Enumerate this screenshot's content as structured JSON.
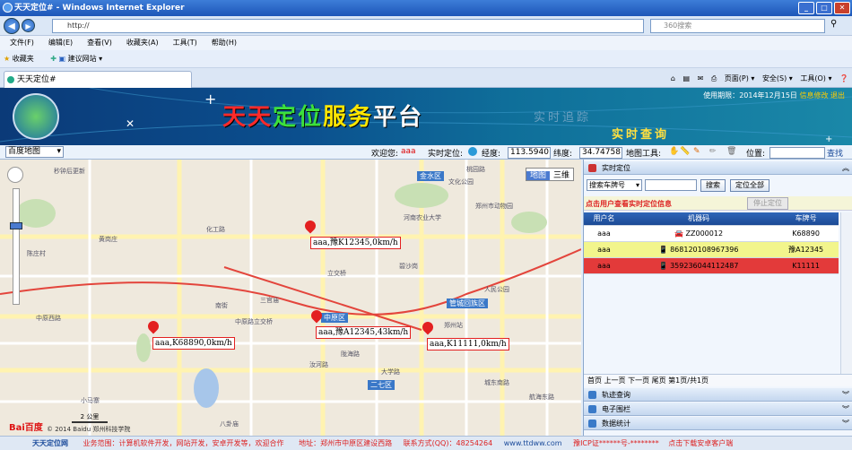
{
  "window": {
    "title": "天天定位# - Windows Internet Explorer"
  },
  "browser": {
    "address": "http://",
    "search_placeholder": "360搜索",
    "menu": [
      "文件(F)",
      "编辑(E)",
      "查看(V)",
      "收藏夹(A)",
      "工具(T)",
      "帮助(H)"
    ],
    "favorites_label": "收藏夹",
    "favorites_item": "建议网站 ▾",
    "tab_title": "天天定位#",
    "tools": [
      "页面(P) ▾",
      "安全(S) ▾",
      "工具(O) ▾"
    ]
  },
  "banner": {
    "title_parts": [
      "天天",
      "定位",
      "服务",
      "平台"
    ],
    "sub1": "实时追踪",
    "sub2": "实时查询",
    "expire_label": "使用期限：",
    "expire_date": "2014年12月15日",
    "info_edit": "信息修改",
    "logout": "退出"
  },
  "controls": {
    "map_type": "百度地图",
    "welcome": "欢迎您:",
    "user": "aaa",
    "realtime": "实时定位:",
    "lng_label": "经度:",
    "lng": "113.5940",
    "lat_label": "纬度:",
    "lat": "34.74758",
    "map_tools": "地图工具:",
    "position": "位置:",
    "search": "查找"
  },
  "map": {
    "view_buttons": [
      "地图",
      "三维"
    ],
    "places": [
      "秒钟后更新",
      "金水区",
      "郑州市动物园",
      "化工路",
      "河南农业大学",
      "黄岗庄",
      "陈庄村",
      "立交桥",
      "三官庙",
      "南街",
      "中原西路",
      "中原路立交桥",
      "郑州站",
      "管城回族区",
      "中原区",
      "陇海路",
      "二七区",
      "大学路",
      "汝河路",
      "城东南路",
      "航海东路",
      "小马寨",
      "桃园路",
      "碧沙岗",
      "人民公园",
      "文化公园",
      "八卦庙"
    ],
    "scale": "2 公里",
    "copyright": "© 2014 Baidu 郑州科技学院",
    "baidu": "Bai百度",
    "markers": [
      {
        "label": "aaa,豫K12345,0km/h"
      },
      {
        "label": "aaa,豫A12345,43km/h"
      },
      {
        "label": "aaa,K68890,0km/h"
      },
      {
        "label": "aaa,K11111,0km/h"
      }
    ]
  },
  "panel": {
    "header": "实时定位",
    "search_select": "搜索车牌号",
    "search_button": "搜索",
    "locate_all": "定位全部",
    "hint": "点击用户查看实时定位信息",
    "stop_button": "停止定位",
    "columns": [
      "用户名",
      "机器码",
      "车牌号"
    ],
    "rows": [
      {
        "user": "aaa",
        "code": "ZZ000012",
        "plate": "K68890",
        "color": "#ffffff"
      },
      {
        "user": "aaa",
        "code": "868120108967396",
        "plate": "豫A12345",
        "color": "#f2f58c"
      },
      {
        "user": "aaa",
        "code": "359236044112487",
        "plate": "K11111",
        "color": "#e33a3a"
      }
    ],
    "pager": "首页 上一页 下一页 尾页 第1页/共1页",
    "sections": [
      "轨迹查询",
      "电子围栏",
      "数据统计"
    ]
  },
  "footer": {
    "brand": "天天定位网",
    "scope": "业务范围：计算机软件开发，网站开发，安卓开发等，欢迎合作",
    "address": "地址：郑州市中原区建设西路",
    "contact": "联系方式(QQ)：48254264",
    "site": "www.ttdww.com",
    "icp": "豫ICP证******号-********",
    "download": "点击下载安卓客户端"
  },
  "colors": {
    "marker": "#e32020",
    "header_blue": "#1c4a95",
    "row_selected": "#e33a3a",
    "row_highlight": "#f2f58c"
  }
}
